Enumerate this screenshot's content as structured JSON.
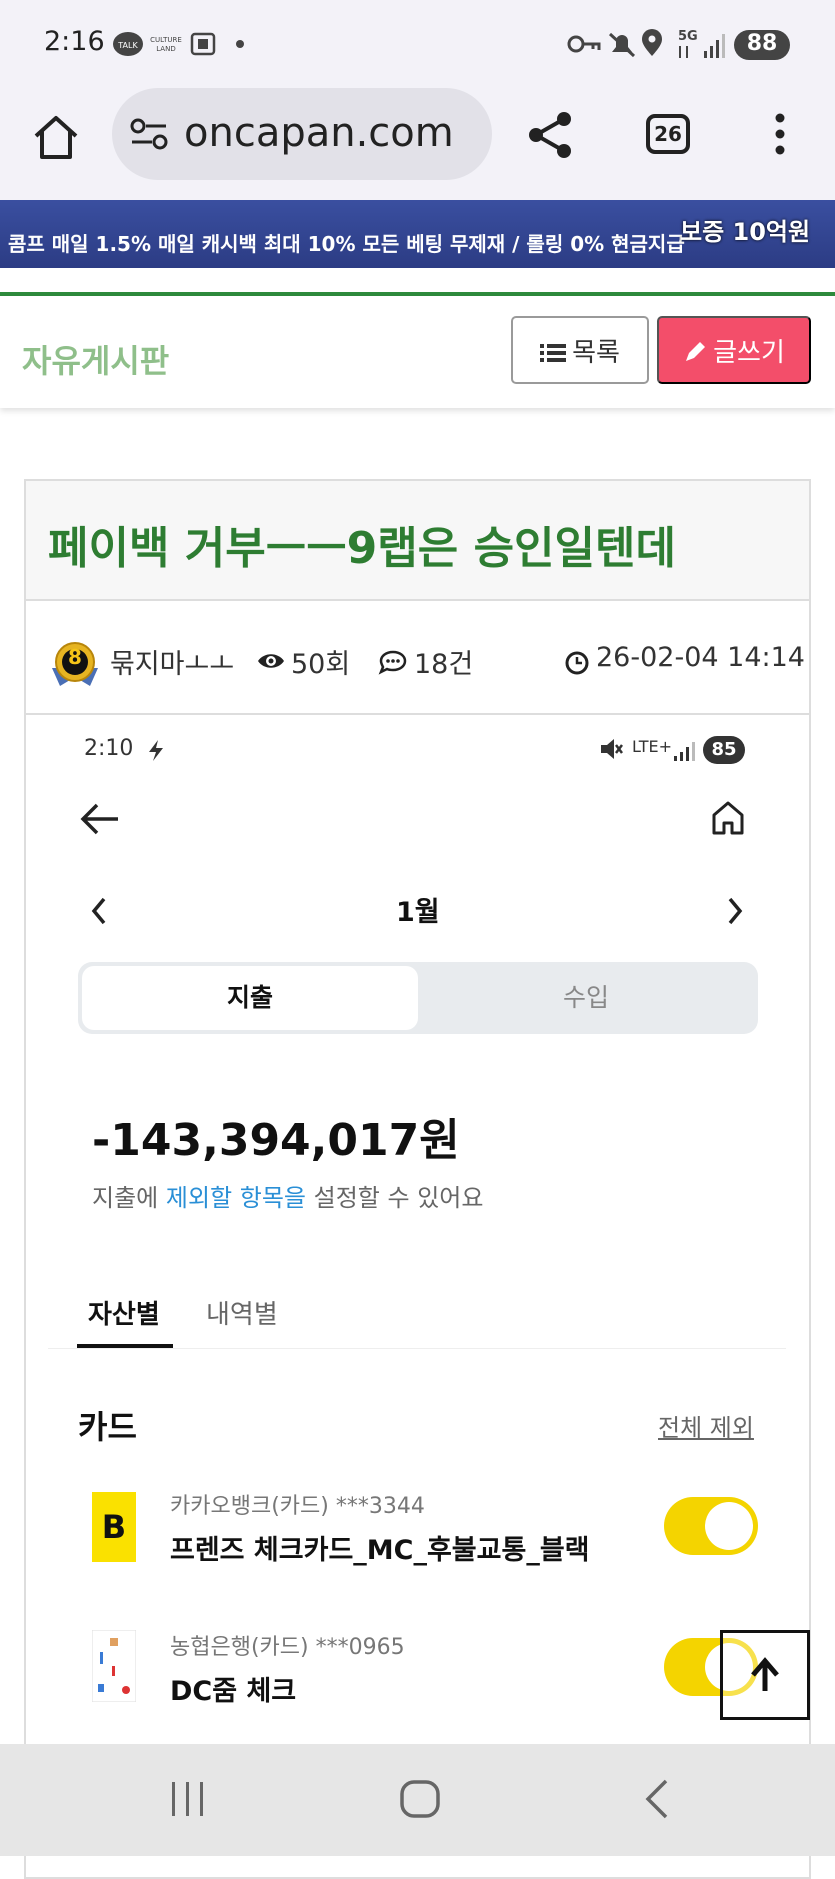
{
  "status_bar": {
    "time": "2:16",
    "battery": "88",
    "icons": [
      "talk-icon",
      "culture-land-icon",
      "screenshot-icon",
      "dot-icon",
      "key-icon",
      "mute-icon",
      "location-icon",
      "5g-icon",
      "signal-icon",
      "battery-icon"
    ]
  },
  "browser": {
    "url": "oncapan.com",
    "tab_count": "26"
  },
  "banner": {
    "text": "콤프 매일 1.5% 매일 캐시백 최대 10% 모든 베팅 무제재 / 롤링 0% 현금지급",
    "badge": "보증 10억원"
  },
  "board": {
    "title": "자유게시판",
    "list_button": "목록",
    "write_button": "글쓰기"
  },
  "post": {
    "title": "페이백 거부ㅡㅡ9랩은 승인일텐데",
    "author": "묶지마ㅗㅗ",
    "author_level": "8",
    "views": "50회",
    "comments": "18건",
    "date": "26-02-04 14:14"
  },
  "inner_screenshot": {
    "time": "2:10",
    "network": "LTE+",
    "battery": "85",
    "month": "1월",
    "segments": {
      "active": "지출",
      "inactive": "수입"
    },
    "amount": "-143,394,017원",
    "exclude_note_pre": "지출에 ",
    "exclude_note_link": "제외할 항목을",
    "exclude_note_post": " 설정할 수 있어요",
    "tabs": {
      "active": "자산별",
      "inactive": "내역별"
    },
    "section": "카드",
    "exclude_all": "전체 제외",
    "cards": [
      {
        "bank": "카카오뱅크(카드) ***3344",
        "name": "프렌즈 체크카드_MC_후불교통_블랙",
        "logo": "B",
        "enabled": true
      },
      {
        "bank": "농협은행(카드) ***0965",
        "name": "DC줌 체크",
        "enabled": true
      }
    ]
  },
  "colors": {
    "green_title": "#2e7d32",
    "board_title": "#8fbf8a",
    "write_button": "#f34e6a",
    "toggle": "#f4d400",
    "link_blue": "#2a8fd6"
  }
}
